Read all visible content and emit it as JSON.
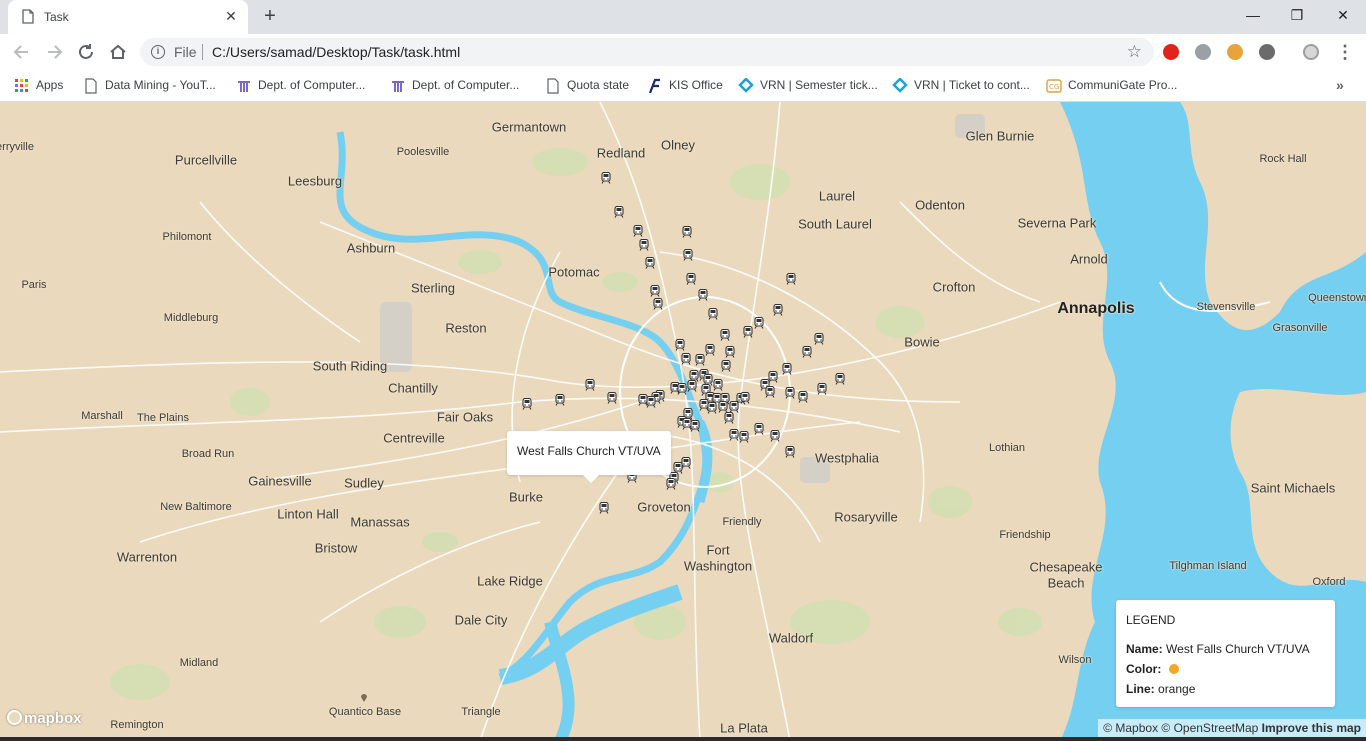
{
  "tab": {
    "title": "Task",
    "close": "✕"
  },
  "newtab": "+",
  "window": {
    "minimize": "—",
    "restore": "❐",
    "close": "✕"
  },
  "omnibox": {
    "scheme": "File",
    "url": "C:/Users/samad/Desktop/Task/task.html"
  },
  "bookmarks": [
    {
      "label": "Apps",
      "icon": "apps-grid-icon"
    },
    {
      "label": "Data Mining - YouT...",
      "icon": "page-icon"
    },
    {
      "label": "Dept. of Computer...",
      "icon": "university-logo-icon"
    },
    {
      "label": "Dept. of Computer...",
      "icon": "university-logo-icon"
    },
    {
      "label": "Quota state",
      "icon": "page-icon"
    },
    {
      "label": "KIS Office",
      "icon": "kis-logo-icon"
    },
    {
      "label": "VRN | Semester tick...",
      "icon": "vrn-logo-icon"
    },
    {
      "label": "VRN | Ticket to cont...",
      "icon": "vrn-logo-icon"
    },
    {
      "label": "CommuniGate Pro...",
      "icon": "communigate-icon"
    }
  ],
  "bookmarks_more": "»",
  "map": {
    "places": [
      {
        "name": "Germantown",
        "size": "big"
      },
      {
        "name": "Redland",
        "size": "big"
      },
      {
        "name": "Olney",
        "size": "big"
      },
      {
        "name": "Glen Burnie",
        "size": "big"
      },
      {
        "name": "Poolesville",
        "size": "sm"
      },
      {
        "name": "Purcellville",
        "size": "big"
      },
      {
        "name": "Leesburg",
        "size": "big"
      },
      {
        "name": "erryville",
        "size": "sm"
      },
      {
        "name": "Laurel",
        "size": "big"
      },
      {
        "name": "Odenton",
        "size": "big"
      },
      {
        "name": "South Laurel",
        "size": "big"
      },
      {
        "name": "Severna Park",
        "size": "big"
      },
      {
        "name": "Rock Hall",
        "size": "sm"
      },
      {
        "name": "Philomont",
        "size": "sm"
      },
      {
        "name": "Ashburn",
        "size": "big"
      },
      {
        "name": "Potomac",
        "size": "big"
      },
      {
        "name": "Arnold",
        "size": "big"
      },
      {
        "name": "Paris",
        "size": "sm"
      },
      {
        "name": "Sterling",
        "size": "big"
      },
      {
        "name": "Crofton",
        "size": "big"
      },
      {
        "name": "Annapolis",
        "size": "cap"
      },
      {
        "name": "Stevensville",
        "size": "sm"
      },
      {
        "name": "Queenstown",
        "size": "sm"
      },
      {
        "name": "Grasonville",
        "size": "sm"
      },
      {
        "name": "Middleburg",
        "size": "sm"
      },
      {
        "name": "Reston",
        "size": "big"
      },
      {
        "name": "Bowie",
        "size": "big"
      },
      {
        "name": "South Riding",
        "size": "big"
      },
      {
        "name": "Chantilly",
        "size": "big"
      },
      {
        "name": "Marshall",
        "size": "sm"
      },
      {
        "name": "The Plains",
        "size": "sm"
      },
      {
        "name": "Fair Oaks",
        "size": "big"
      },
      {
        "name": "Centreville",
        "size": "big"
      },
      {
        "name": "Broad Run",
        "size": "sm"
      },
      {
        "name": "Lothian",
        "size": "sm"
      },
      {
        "name": "Westphalia",
        "size": "big"
      },
      {
        "name": "Gainesville",
        "size": "big"
      },
      {
        "name": "Sudley",
        "size": "big"
      },
      {
        "name": "Burke",
        "size": "big"
      },
      {
        "name": "Saint Michaels",
        "size": "big"
      },
      {
        "name": "New Baltimore",
        "size": "sm"
      },
      {
        "name": "Linton Hall",
        "size": "big"
      },
      {
        "name": "Groveton",
        "size": "big"
      },
      {
        "name": "Rosaryville",
        "size": "big"
      },
      {
        "name": "Manassas",
        "size": "big"
      },
      {
        "name": "Friendly",
        "size": "sm"
      },
      {
        "name": "Friendship",
        "size": "sm"
      },
      {
        "name": "Bristow",
        "size": "big"
      },
      {
        "name": "Fort",
        "size": "big"
      },
      {
        "name": "Washington",
        "size": "big"
      },
      {
        "name": "Warrenton",
        "size": "big"
      },
      {
        "name": "Chesapeake",
        "size": "big"
      },
      {
        "name": "Beach",
        "size": "big"
      },
      {
        "name": "Tilghman Island",
        "size": "sm"
      },
      {
        "name": "Lake Ridge",
        "size": "big"
      },
      {
        "name": "Oxford",
        "size": "sm"
      },
      {
        "name": "Dale City",
        "size": "big"
      },
      {
        "name": "Waldorf",
        "size": "big"
      },
      {
        "name": "Midland",
        "size": "sm"
      },
      {
        "name": "Wilson",
        "size": "sm"
      },
      {
        "name": "Quantico Base",
        "size": "sm"
      },
      {
        "name": "Triangle",
        "size": "sm"
      },
      {
        "name": "Remington",
        "size": "sm"
      },
      {
        "name": "La Plata",
        "size": "big"
      }
    ],
    "popup_text": "West Falls Church VT/UVA",
    "legend": {
      "title": "LEGEND",
      "name_label": "Name:",
      "name_value": "West Falls Church VT/UVA",
      "color_label": "Color:",
      "color_value": "#f5a623",
      "line_label": "Line:",
      "line_value": "orange"
    },
    "logo": "mapbox",
    "attribution": "© Mapbox © OpenStreetMap",
    "improve": "Improve this map"
  }
}
